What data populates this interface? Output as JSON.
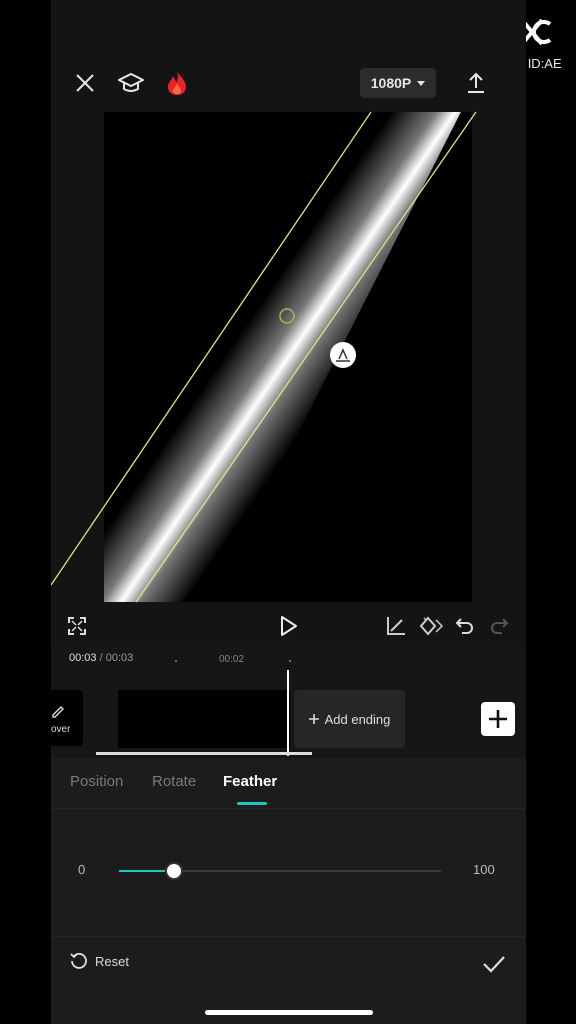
{
  "watermark": {
    "text": "CapCut ID:AE"
  },
  "topbar": {
    "icons": [
      "close-icon",
      "tutorial-cap-icon",
      "flame-icon",
      "export-upload-icon"
    ],
    "resolution_label": "1080P"
  },
  "controls": {
    "icons": [
      "fullscreen-icon",
      "play-icon",
      "keyframe-graph-icon",
      "keyframe-add-icon",
      "undo-icon",
      "redo-icon"
    ]
  },
  "timeline": {
    "current_time": "00:03",
    "separator": "/",
    "total_time": "00:03",
    "tick_label": "00:02",
    "cover_label": "over",
    "add_ending_label": "Add ending"
  },
  "tabs": {
    "items": [
      {
        "label": "Position"
      },
      {
        "label": "Rotate"
      },
      {
        "label": "Feather"
      }
    ],
    "active": "Feather"
  },
  "slider": {
    "min_label": "0",
    "max_label": "100",
    "value_fraction": 0.17
  },
  "bottom": {
    "reset_label": "Reset"
  },
  "colors": {
    "accent": "#1fc6c6",
    "flame": "#e8242b",
    "mask_line": "#e6e08a"
  }
}
